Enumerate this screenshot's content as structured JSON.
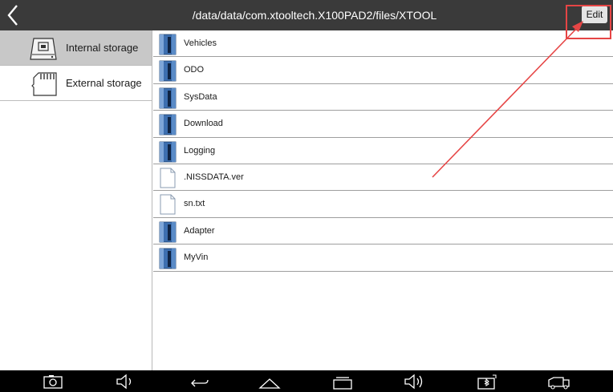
{
  "header": {
    "path": "/data/data/com.xtooltech.X100PAD2/files/XTOOL",
    "edit_label": "Edit"
  },
  "sidebar": {
    "items": [
      {
        "label": "Internal storage",
        "icon": "internal-storage-icon",
        "active": true
      },
      {
        "label": "External storage",
        "icon": "sd-card-icon",
        "active": false
      }
    ]
  },
  "files": [
    {
      "name": "Vehicles",
      "type": "folder"
    },
    {
      "name": "ODO",
      "type": "folder"
    },
    {
      "name": "SysData",
      "type": "folder"
    },
    {
      "name": "Download",
      "type": "folder"
    },
    {
      "name": "Logging",
      "type": "folder"
    },
    {
      "name": ".NISSDATA.ver",
      "type": "file"
    },
    {
      "name": "sn.txt",
      "type": "file"
    },
    {
      "name": "Adapter",
      "type": "folder"
    },
    {
      "name": "MyVin",
      "type": "folder"
    }
  ],
  "navbar": {
    "buttons": [
      "screenshot-icon",
      "volume-down-icon",
      "back-icon",
      "home-icon",
      "recent-apps-icon",
      "volume-up-icon",
      "bluetooth-module-icon",
      "vci-connector-icon"
    ]
  },
  "colors": {
    "topbar": "#3a3a3a",
    "navbar": "#000000",
    "active_sidebar": "#c8c8c8",
    "annotation": "#e64545",
    "folder": "#3d6fb0"
  }
}
